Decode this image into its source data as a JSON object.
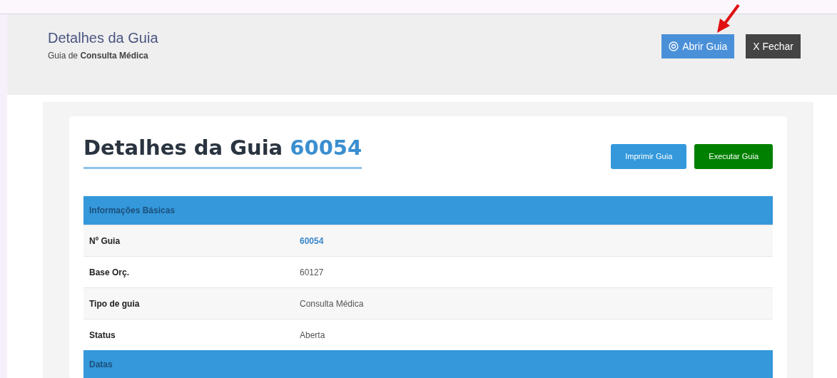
{
  "header": {
    "title": "Detalhes da Guia",
    "subtitle": "Guia de **Consulta Médica**"
  },
  "header_buttons": [
    {
      "label": "Abrir Guia",
      "kind": "open",
      "annotated": true
    },
    {
      "label": "X Fechar",
      "kind": "close",
      "annotated": false
    }
  ],
  "card": {
    "title": "Detalhes da Guia",
    "number": "60054",
    "buttons": [
      {
        "label": "Imprimir Guia",
        "kind": "print"
      },
      {
        "label": "Executar Guia",
        "kind": "execute"
      }
    ]
  },
  "sections": [
    {
      "title": "Informações Básicas",
      "rows": [
        {
          "label": "Nº Guia",
          "value": "60054",
          "kind": "link"
        },
        {
          "label": "Base Orç.",
          "value": "60127",
          "kind": "text"
        },
        {
          "label": "Tipo de guia",
          "value": "Consulta Médica",
          "kind": "text"
        },
        {
          "label": "Status",
          "value": "Aberta",
          "kind": "text"
        }
      ]
    },
    {
      "title": "Datas"
    }
  ]
}
